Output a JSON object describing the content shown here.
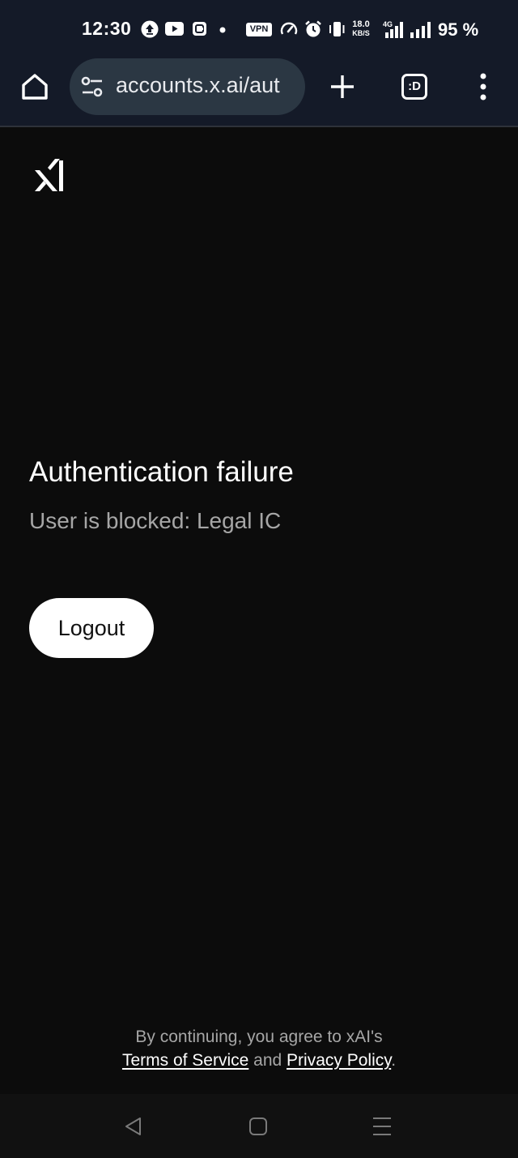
{
  "status_bar": {
    "time": "12:30",
    "vpn_label": "VPN",
    "speed_value": "18.0",
    "speed_unit": "KB/S",
    "network": "4G",
    "battery": "95 %",
    "icons": [
      "upload-icon",
      "youtube-icon",
      "app-notification-icon",
      "dot-icon",
      "vpn-icon",
      "speedometer-icon",
      "alarm-icon",
      "vibrate-icon",
      "signal-icon",
      "signal-icon"
    ]
  },
  "browser": {
    "url": "accounts.x.ai/aut",
    "tab_label": ":D",
    "icons": [
      "home-icon",
      "site-settings-icon",
      "plus-icon",
      "tabs-icon",
      "more-vert-icon"
    ]
  },
  "page": {
    "title": "Authentication failure",
    "message": "User is blocked: Legal IC",
    "logout_label": "Logout"
  },
  "footer": {
    "prefix": "By continuing, you agree to xAI's",
    "terms_label": "Terms of Service",
    "and_text": " and ",
    "privacy_label": "Privacy Policy",
    "suffix": "."
  },
  "nav": {
    "icons": [
      "back-icon",
      "home-square-icon",
      "recents-icon"
    ]
  },
  "colors": {
    "background": "#0c0c0c",
    "chrome": "#141a28",
    "url_bar": "#2b3743",
    "muted_text": "#a6a6a6",
    "button": "#ffffff"
  }
}
